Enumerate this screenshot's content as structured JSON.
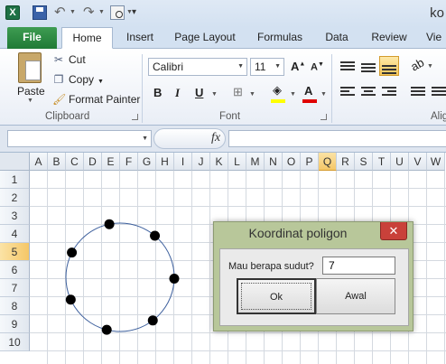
{
  "window_title": "ko",
  "tabs": [
    "File",
    "Home",
    "Insert",
    "Page Layout",
    "Formulas",
    "Data",
    "Review",
    "Vie"
  ],
  "ribbon": {
    "clipboard": {
      "paste": "Paste",
      "cut": "Cut",
      "copy": "Copy",
      "format_painter": "Format Painter",
      "label": "Clipboard"
    },
    "font": {
      "name": "Calibri",
      "size": "11",
      "label": "Font"
    },
    "alignment": {
      "label": "Alig"
    }
  },
  "formula_bar": {
    "fx": "fx"
  },
  "columns": [
    "A",
    "B",
    "C",
    "D",
    "E",
    "F",
    "G",
    "H",
    "I",
    "J",
    "K",
    "L",
    "M",
    "N",
    "O",
    "P",
    "Q",
    "R",
    "S",
    "T",
    "U",
    "V",
    "W"
  ],
  "rows": [
    "1",
    "2",
    "3",
    "4",
    "5",
    "6",
    "7",
    "8",
    "9",
    "10"
  ],
  "selected_column": "Q",
  "selected_row": "5",
  "dialog": {
    "title": "Koordinat poligon",
    "close": "✕",
    "label": "Mau berapa sudut?",
    "value": "7",
    "ok_button": "Ok",
    "awal_button": "Awal"
  },
  "polygon": {
    "vertices": 7
  }
}
